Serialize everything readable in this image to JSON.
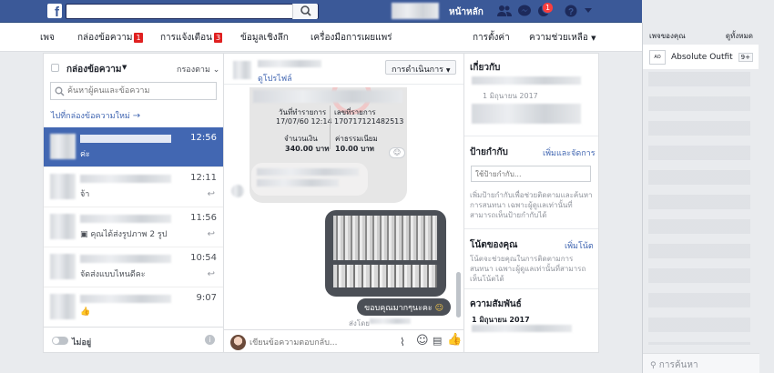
{
  "topbar": {
    "logo": "f",
    "home_label": "หน้าหลัก",
    "notif_count": "1"
  },
  "subnav": {
    "page": "เพจ",
    "inbox": "กล่องข้อความ",
    "inbox_count": "1",
    "notifications": "การแจ้งเตือน",
    "notif_count": "3",
    "insights": "ข้อมูลเชิงลึก",
    "publishing_tools": "เครื่องมือการเผยแพร่",
    "settings": "การตั้งค่า",
    "help": "ความช่วยเหลือ"
  },
  "inbox": {
    "title": "กล่องข้อความ",
    "filter": "กรองตาม",
    "search_placeholder": "ค้นหาผู้คนและข้อความ",
    "new_inbox_link": "ไปที่กล่องข้อความใหม่",
    "conversations": [
      {
        "preview": "ค่ะ",
        "time": "12:56"
      },
      {
        "preview": "จ้า",
        "time": "12:11"
      },
      {
        "preview": "คุณได้ส่งรูปภาพ 2 รูป",
        "time": "11:56"
      },
      {
        "preview": "จัดส่งแบบไหนดีคะ",
        "time": "10:54"
      },
      {
        "preview": "",
        "time": "9:07"
      }
    ],
    "status": "ไม่อยู่"
  },
  "chat": {
    "profile_link": "ดูโปรไฟล์",
    "actions": "การดำเนินการ",
    "receipt": {
      "date_label": "วันที่ทำรายการ",
      "date_value": "17/07/60 12:14",
      "ref_label": "เลขที่รายการ",
      "ref_value": "170717121482513",
      "amount_label": "จำนวนเงิน",
      "amount_value": "340.00 บาท",
      "fee_label": "ค่าธรรมเนียม",
      "fee_value": "10.00 บาท"
    },
    "outgoing_text": "ขอบคุณมากๆนะคะ",
    "sent_by": "ส่งโดย",
    "input_placeholder": "เขียนข้อความตอบกลับ..."
  },
  "details": {
    "about_title": "เกี่ยวกับ",
    "about_date": "1 มิถุนายน 2017",
    "tags_title": "ป้ายกำกับ",
    "tags_link": "เพิ่มและจัดการ",
    "tags_placeholder": "ใช้ป้ายกำกับ...",
    "tags_help": "เพิ่มป้ายกำกับเพื่อช่วยติดตามและค้นหาการสนทนา เฉพาะผู้ดูแลเท่านั้นที่สามารถเห็นป้ายกำกับได้",
    "notes_title": "โน้ตของคุณ",
    "notes_link": "เพิ่มโน้ต",
    "notes_help": "โน้ตจะช่วยคุณในการติดตามการสนทนา เฉพาะผู้ดูแลเท่านั้นที่สามารถเห็นโน้ตได้",
    "relationship_title": "ความสัมพันธ์",
    "relationship_date": "1 มิถุนายน 2017"
  },
  "right_sidebar": {
    "header_left": "เพจของคุณ",
    "header_right": "ดูทั้งหมด",
    "page_name": "Absolute Outfit",
    "page_count": "9+",
    "search_placeholder": "การค้นหา"
  }
}
